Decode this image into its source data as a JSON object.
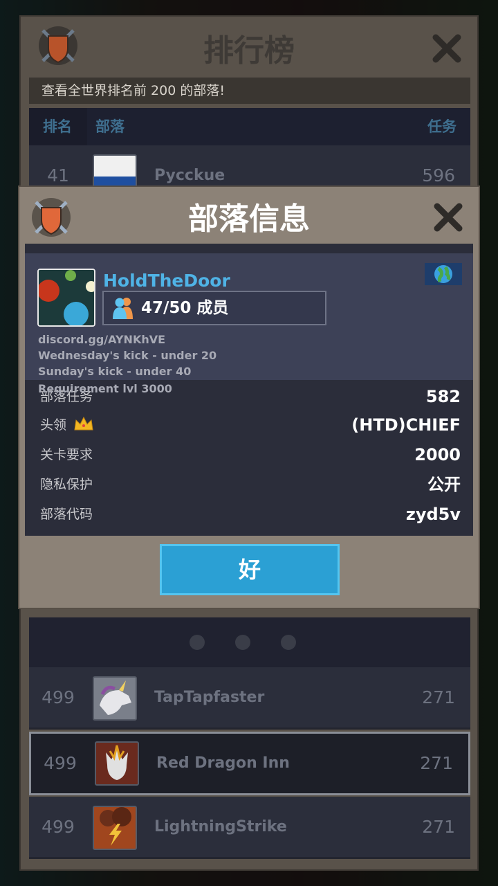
{
  "leaderboard": {
    "title": "排行榜",
    "subtitle": "查看全世界排名前 200 的部落!",
    "columns": {
      "rank": "排名",
      "clan": "部落",
      "quests": "任务"
    },
    "rows_top": [
      {
        "rank": "41",
        "name": "Pycckue",
        "score": "596"
      }
    ],
    "rows_bottom": [
      {
        "rank": "499",
        "name": "TapTapfaster",
        "score": "271"
      },
      {
        "rank": "499",
        "name": "Red Dragon Inn",
        "score": "271"
      },
      {
        "rank": "499",
        "name": "LightningStrike",
        "score": "271"
      }
    ]
  },
  "clan_info": {
    "title": "部落信息",
    "clan_name": "HoldTheDoor",
    "members": "47/50 成员",
    "description": [
      "discord.gg/AYNKhVE",
      "Wednesday's kick - under 20",
      "Sunday's kick - under 40",
      "Requirement lvl 3000"
    ],
    "stats": [
      {
        "label": "部落任务",
        "value": "582"
      },
      {
        "label": "头领",
        "value": "(HTD)CHIEF"
      },
      {
        "label": "关卡要求",
        "value": "2000"
      },
      {
        "label": "隐私保护",
        "value": "公开"
      },
      {
        "label": "部落代码",
        "value": "zyd5v"
      }
    ],
    "ok_label": "好"
  },
  "icons": {
    "clan_badge": "shield-crossed-swords-icon",
    "close": "close-x-icon",
    "region": "globe-flag-icon",
    "members": "people-icon",
    "leader": "crown-icon"
  },
  "colors": {
    "accent": "#4fb3e6",
    "button": "#2ba0d4",
    "panel": "#8c8277"
  }
}
